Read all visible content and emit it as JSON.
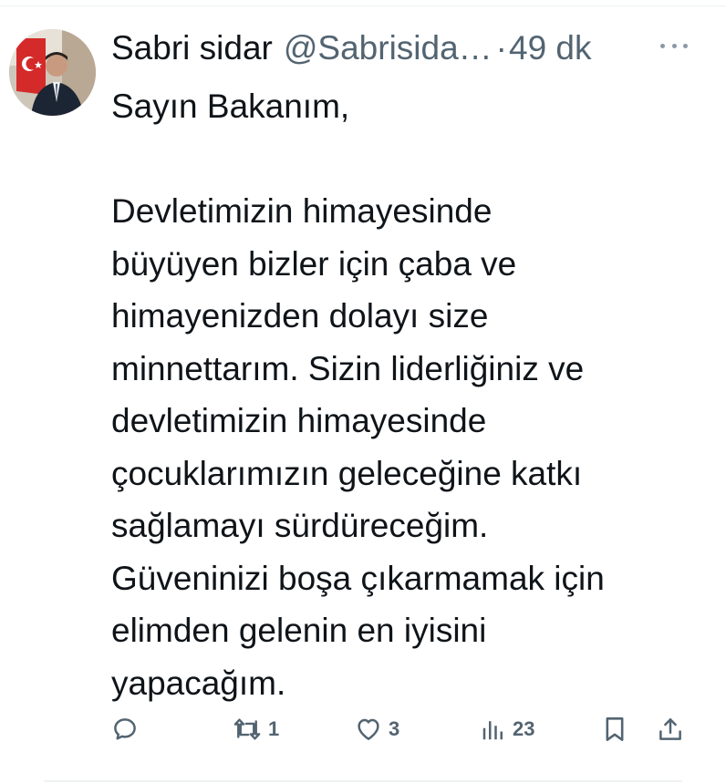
{
  "tweet": {
    "author_name": "Sabri sidar",
    "author_handle": "@Sabrisida…",
    "separator": "·",
    "time": "49 dk",
    "text": "Sayın Bakanım,\n\nDevletimizin himayesinde\nbüyüyen bizler için çaba ve\nhimayenizden dolayı size\nminnettarım. Sizin liderliğiniz ve\ndevletimizin himayesinde\nçocuklarımızın geleceğine katkı\nsağlamayı sürdüreceğim.\nGüveninizi boşa çıkarmamak için\nelimden gelenin en iyisini\nyapacağım."
  },
  "actions": {
    "reply": {
      "icon": "reply-icon",
      "count": ""
    },
    "retweet": {
      "icon": "retweet-icon",
      "count": "1"
    },
    "like": {
      "icon": "heart-icon",
      "count": "3"
    },
    "views": {
      "icon": "views-chart-icon",
      "count": "23"
    },
    "bookmark": {
      "icon": "bookmark-icon"
    },
    "share": {
      "icon": "share-icon"
    }
  },
  "colors": {
    "text": "#0f1419",
    "secondary": "#536471",
    "divider": "#eff3f4"
  }
}
